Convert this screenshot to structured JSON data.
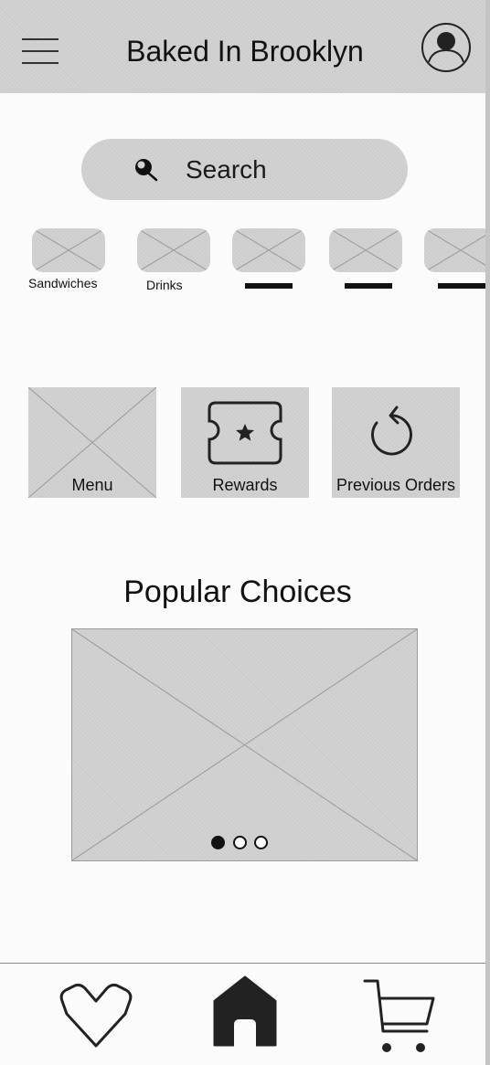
{
  "header": {
    "title": "Baked In Brooklyn",
    "menu_icon": "hamburger-menu-icon",
    "avatar_icon": "user-avatar-icon"
  },
  "search": {
    "label": "Search",
    "icon": "search-icon"
  },
  "categories": [
    {
      "label": "Sandwiches"
    },
    {
      "label": "Drinks"
    },
    {
      "label": ""
    },
    {
      "label": ""
    },
    {
      "label": ""
    }
  ],
  "tiles": [
    {
      "label": "Menu",
      "icon": "image-placeholder-icon"
    },
    {
      "label": "Rewards",
      "icon": "ticket-star-icon"
    },
    {
      "label": "Previous Orders",
      "icon": "refresh-arrow-icon"
    }
  ],
  "popular": {
    "title": "Popular Choices",
    "carousel": {
      "slide_count": 3,
      "active_index": 0
    }
  },
  "bottom_nav": {
    "items": [
      {
        "icon": "heart-icon",
        "active": false
      },
      {
        "icon": "home-icon",
        "active": true
      },
      {
        "icon": "cart-icon",
        "active": false
      }
    ]
  },
  "colors": {
    "placeholder_fill": "#d2d2d2",
    "placeholder_line": "#9a9a9a",
    "ink": "#111111",
    "background": "#fbfbfb"
  }
}
